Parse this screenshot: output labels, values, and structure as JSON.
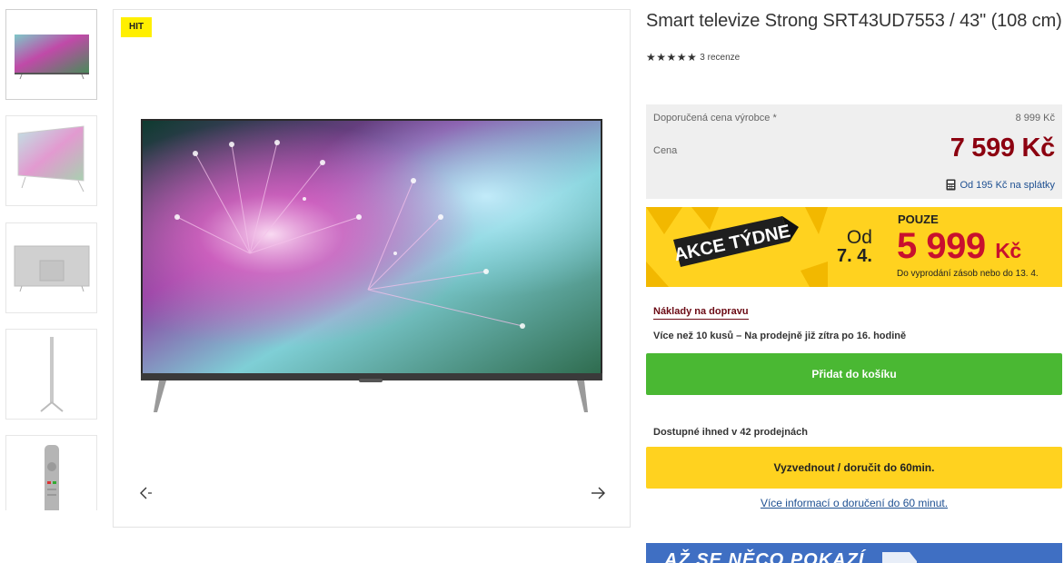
{
  "gallery": {
    "badge": "HIT",
    "thumbnails": [
      "tv-front",
      "tv-angled",
      "tv-back",
      "tv-side",
      "remote"
    ]
  },
  "product": {
    "title": "Smart televize Strong SRT43UD7553 / 43\" (108 cm)",
    "stars": "★★★★★",
    "reviews": "3 recenze"
  },
  "pricing": {
    "msrp_label": "Doporučená cena výrobce *",
    "msrp_value": "8 999 Kč",
    "price_label": "Cena",
    "price_value": "7 599 Kč",
    "installment": "Od 195 Kč na splátky"
  },
  "promo": {
    "banner_text": "AKCE TÝDNE",
    "od": "Od",
    "date": "7. 4.",
    "pouze": "POUZE",
    "price_number": "5 999",
    "price_currency": "Kč",
    "note": "Do vyprodání zásob nebo do 13. 4."
  },
  "delivery": {
    "shipping_link": "Náklady na dopravu",
    "stock_text": "Více než 10 kusů  – Na prodejně již zítra po 16. hodině",
    "cart_button": "Přidat do košíku",
    "availability": "Dostupné ihned v 42 prodejnách",
    "pickup_button": "Vyzvednout / doručit do 60min.",
    "more_info_link": "Více informací o doručení do 60 minut."
  },
  "bottom_banner": {
    "text": "AŽ SE NĚCO POKAZÍ"
  },
  "colors": {
    "price_red": "#8c0010",
    "promo_yellow": "#ffd21f",
    "cart_green": "#4ab833",
    "link_blue": "#1d4f91"
  }
}
